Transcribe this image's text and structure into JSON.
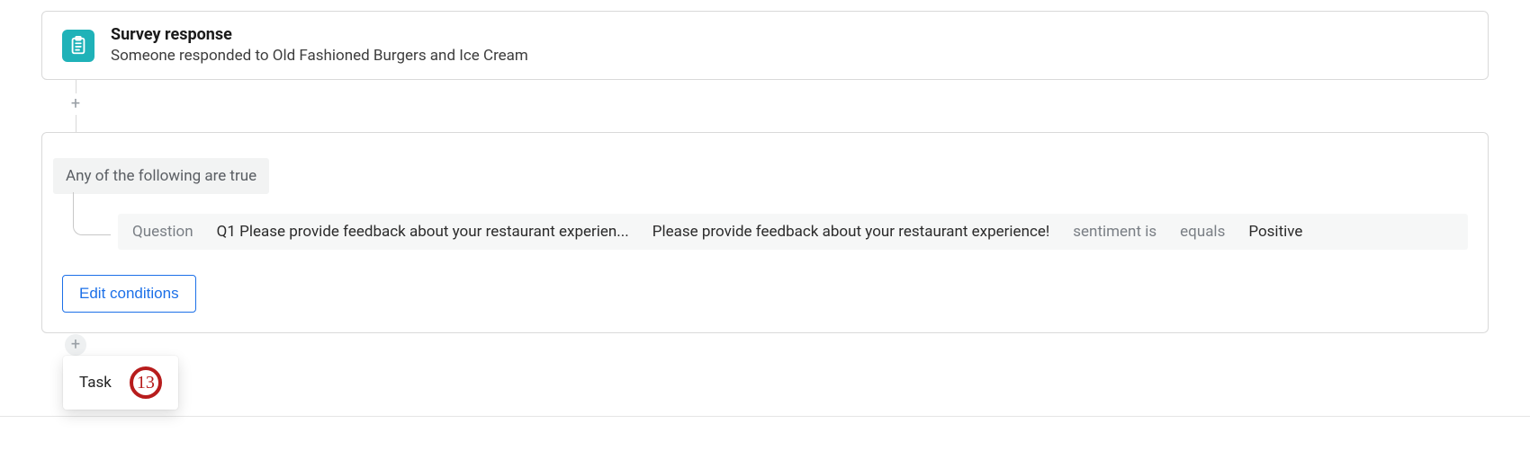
{
  "trigger": {
    "title": "Survey response",
    "subtitle": "Someone responded to Old Fashioned Burgers and Ice Cream"
  },
  "conditions": {
    "header": "Any of the following are true",
    "row": {
      "field_label": "Question",
      "question_ref": "Q1 Please provide feedback about your restaurant experien...",
      "question_text": "Please provide feedback about your restaurant experience!",
      "attribute": "sentiment is",
      "operator": "equals",
      "value": "Positive"
    },
    "edit_label": "Edit conditions"
  },
  "popover": {
    "task_label": "Task",
    "annotation_number": "13"
  }
}
